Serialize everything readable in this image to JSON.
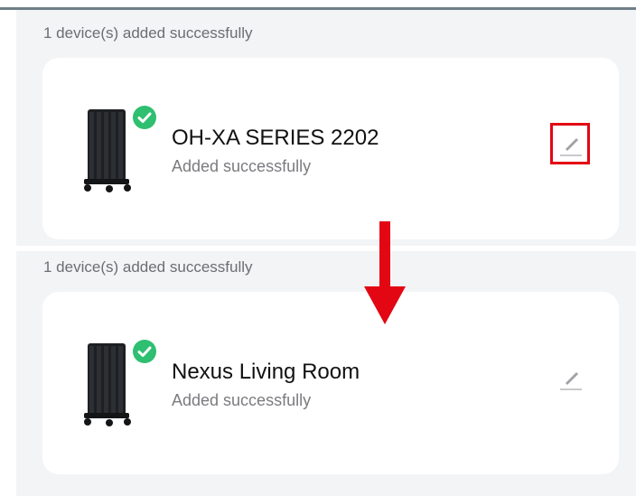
{
  "top": {
    "title": "1 device(s) added successfully",
    "device": {
      "name": "OH-XA SERIES 2202",
      "status": "Added successfully",
      "icon": "oil-radiator-heater",
      "badge": "check-icon"
    },
    "edit_icon": "pencil-icon",
    "highlight_color": "#e30613"
  },
  "bottom": {
    "title": "1 device(s) added successfully",
    "device": {
      "name": "Nexus Living Room",
      "status": "Added successfully",
      "icon": "oil-radiator-heater",
      "badge": "check-icon"
    },
    "edit_icon": "pencil-icon"
  },
  "colors": {
    "check_green": "#2fbf71",
    "arrow_red": "#e30613",
    "panel_bg": "#f3f4f6"
  }
}
